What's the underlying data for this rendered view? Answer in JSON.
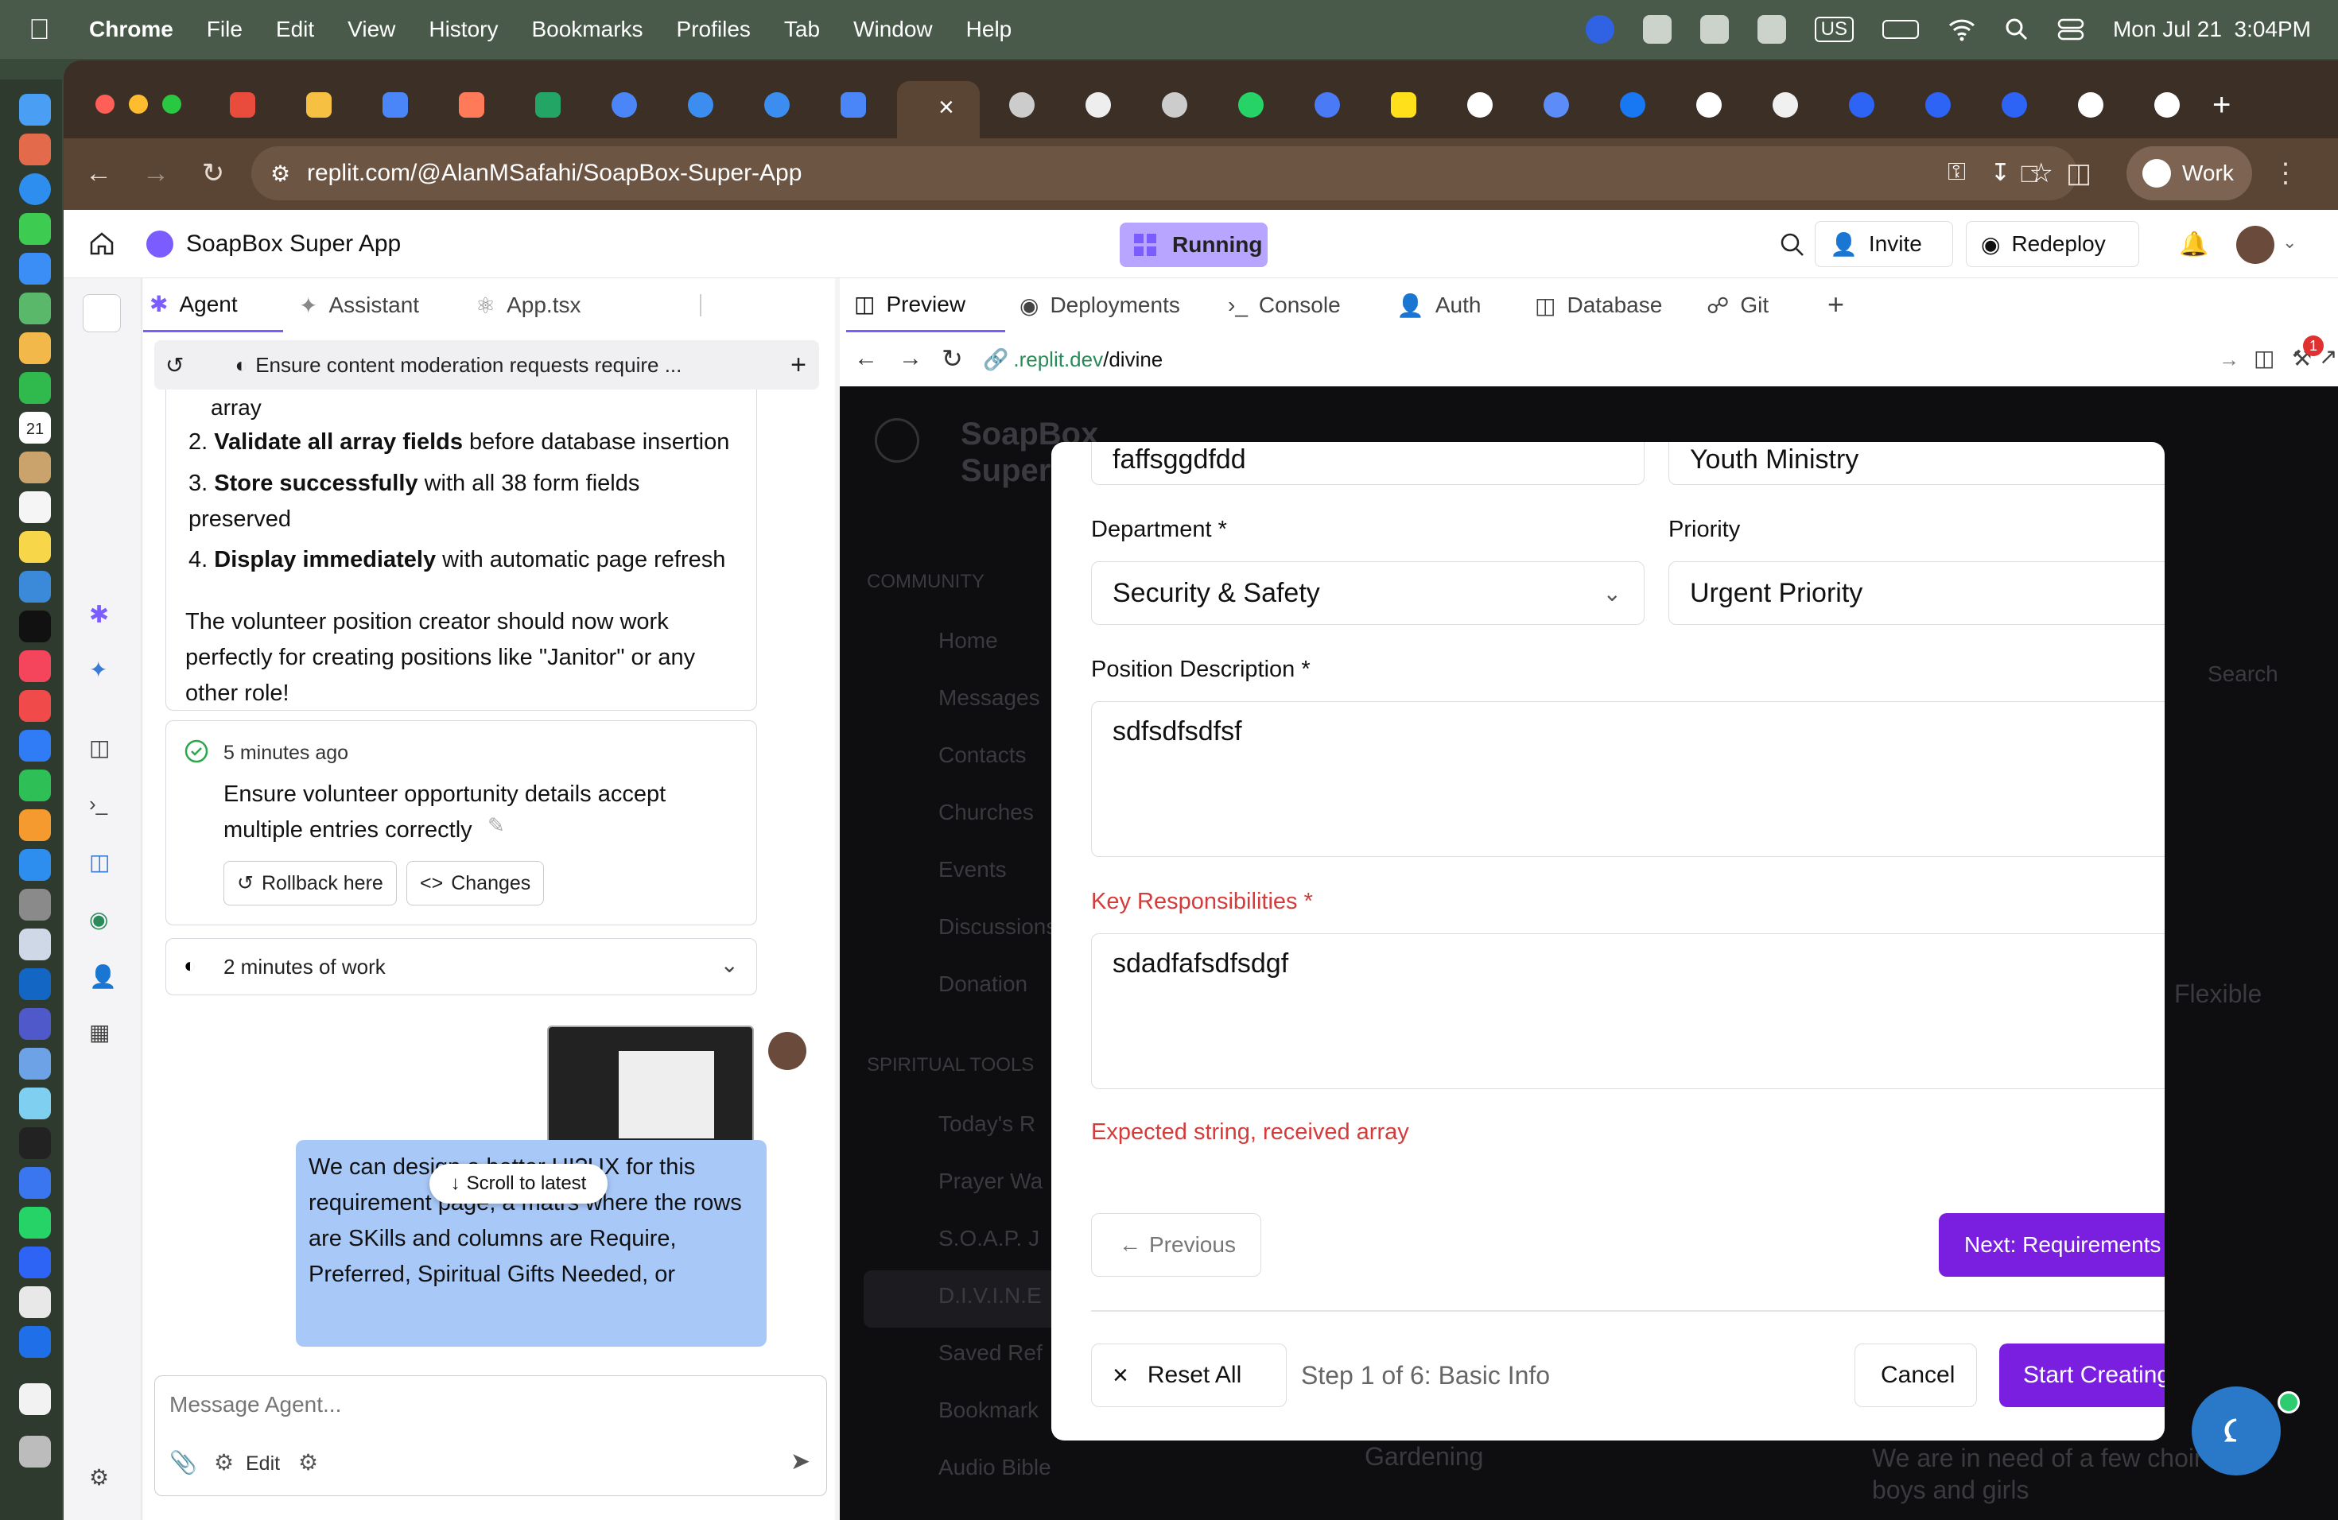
{
  "menubar": {
    "app": "Chrome",
    "items": [
      "File",
      "Edit",
      "View",
      "History",
      "Bookmarks",
      "Profiles",
      "Tab",
      "Window",
      "Help"
    ],
    "input_source": "US",
    "datetime": "Mon Jul 21  3:04PM"
  },
  "dock": {
    "calendar_day": "21"
  },
  "browser": {
    "url": "replit.com/@AlanMSafahi/SoapBox-Super-App",
    "profile": "Work"
  },
  "replit": {
    "project_name": "SoapBox Super App",
    "status": "Running",
    "invite": "Invite",
    "redeploy": "Redeploy",
    "left_tabs": [
      "Agent",
      "Assistant",
      "App.tsx"
    ],
    "session_title": "Ensure content moderation requests require ...",
    "chat": {
      "cut_line": "array",
      "steps": [
        {
          "num": "2.",
          "bold": "Validate all array fields",
          "rest": " before database insertion"
        },
        {
          "num": "3.",
          "bold": "Store successfully",
          "rest": " with all 38 form fields preserved"
        },
        {
          "num": "4.",
          "bold": "Display immediately",
          "rest": " with automatic page refresh"
        }
      ],
      "summary": "The volunteer position creator should now work perfectly for creating positions like \"Janitor\" or any other role!",
      "checkpoint_time": "5 minutes ago",
      "checkpoint_text": "Ensure volunteer opportunity details accept multiple entries correctly",
      "rollback": "Rollback here",
      "changes": "Changes",
      "work_time": "2 minutes of work",
      "user_message": "We can design a better UI?UX for this requirement page, a matrs where the rows are SKills and columns are Require, Preferred, Spiritual Gifts Needed, or",
      "scroll_pill": "Scroll to latest",
      "composer_placeholder": "Message Agent...",
      "edit": "Edit"
    },
    "right_tabs": [
      "Preview",
      "Deployments",
      "Console",
      "Auth",
      "Database",
      "Git"
    ],
    "preview_url": {
      "domain": ".replit.dev",
      "path": "/divine"
    },
    "notification_count": "1"
  },
  "background_app": {
    "logo_text": "SoapBox",
    "logo_text2": "Super",
    "section_community": "COMMUNITY",
    "nav": [
      "Home",
      "Messages",
      "Contacts",
      "Churches",
      "Events",
      "Discussions",
      "Donation"
    ],
    "section_spiritual": "SPIRITUAL TOOLS",
    "nav2": [
      "Today's R",
      "Prayer Wa",
      "S.O.A.P. J",
      "D.I.V.I.N.E",
      "Saved Ref",
      "Bookmark",
      "Audio Bible"
    ],
    "search": "Search",
    "flexible": "Flexible",
    "gardening": "Gardening",
    "choir_text": "We are in need of a few choir boys and girls"
  },
  "modal": {
    "field_top_left": "faffsggdfdd",
    "field_top_right": "Youth Ministry",
    "department_label": "Department *",
    "department_value": "Security & Safety",
    "priority_label": "Priority",
    "priority_value": "Urgent Priority",
    "description_label": "Position Description *",
    "description_value": "sdfsdfsdfsf",
    "responsibilities_label": "Key Responsibilities *",
    "responsibilities_value": "sdadfafsdfsdgf",
    "error": "Expected string, received array",
    "previous": "Previous",
    "next": "Next: Requirements",
    "reset": "Reset All",
    "step": "Step 1 of 6: Basic Info",
    "cancel": "Cancel",
    "start": "Start Creating"
  },
  "colors": {
    "accent": "#7a5cff",
    "error": "#d43b3b",
    "running_bg": "#b8a5ff",
    "user_bubble": "#a8c8f8"
  }
}
